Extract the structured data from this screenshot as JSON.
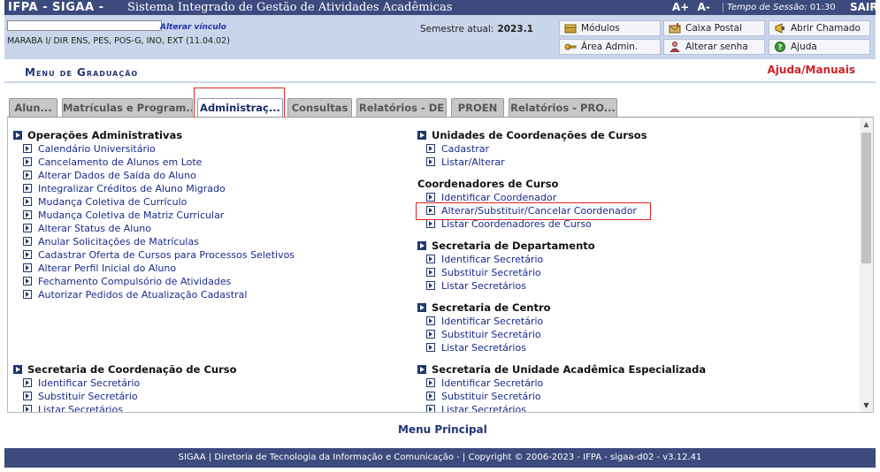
{
  "topbar": {
    "system": "IFPA - SIGAA -",
    "system_name": "Sistema Integrado de Gestão de Atividades Acadêmicas",
    "font_up": "A+",
    "font_down": "A-",
    "session_label": "Tempo de Sessão:",
    "session_time": "01:30",
    "logout": "SAIR"
  },
  "info": {
    "alterar_vinculo": "Alterar vínculo",
    "lotacao": "MARABA I/ DIR ENS, PES, POS-G, INO, EXT (11.04.02)",
    "semestre_label": "Semestre atual:",
    "semestre_value": "2023.1",
    "buttons": {
      "modulos": "Módulos",
      "caixa_postal": "Caixa Postal",
      "abrir_chamado": "Abrir Chamado",
      "area_admin": "Área Admin.",
      "alterar_senha": "Alterar senha",
      "ajuda": "Ajuda"
    }
  },
  "menu": {
    "title": "Menu de Graduação",
    "help": "Ajuda/Manuais"
  },
  "tabs": [
    "Alun...",
    "Matrículas e Program...",
    "Administraç...",
    "Consultas",
    "Relatórios - DE",
    "PROEN",
    "Relatórios - PRO..."
  ],
  "active_tab": "Administraç...",
  "sections": {
    "operacoes": {
      "title": "Operações Administrativas",
      "items": [
        "Calendário Universitário",
        "Cancelamento de Alunos em Lote",
        "Alterar Dados de Saída do Aluno",
        "Integralizar Créditos de Aluno Migrado",
        "Mudança Coletiva de Currículo",
        "Mudança Coletiva de Matriz Curricular",
        "Alterar Status de Aluno",
        "Anular Solicitações de Matrículas",
        "Cadastrar Oferta de Cursos para Processos Seletivos",
        "Alterar Perfil Inicial do Aluno",
        "Fechamento Compulsório de Atividades",
        "Autorizar Pedidos de Atualização Cadastral"
      ]
    },
    "sec_coord_curso": {
      "title": "Secretaria de Coordenação de Curso",
      "items": [
        "Identificar Secretário",
        "Substituir Secretário",
        "Listar Secretários"
      ]
    },
    "unidades_coord": {
      "title": "Unidades de Coordenações de Cursos",
      "items": [
        "Cadastrar",
        "Listar/Alterar"
      ]
    },
    "coordenadores": {
      "title": "Coordenadores de Curso",
      "items": [
        "Identificar Coordenador",
        "Alterar/Substituir/Cancelar Coordenador",
        "Listar Coordenadores de Curso"
      ]
    },
    "sec_depto": {
      "title": "Secretaria de Departamento",
      "items": [
        "Identificar Secretário",
        "Substituir Secretário",
        "Listar Secretários"
      ]
    },
    "sec_centro": {
      "title": "Secretaria de Centro",
      "items": [
        "Identificar Secretário",
        "Substituir Secretário",
        "Listar Secretários"
      ]
    },
    "sec_unidade": {
      "title": "Secretaria de Unidade Acadêmica Especializada",
      "items": [
        "Identificar Secretário",
        "Substituir Secretário",
        "Listar Secretários"
      ]
    }
  },
  "menu_principal": "Menu Principal",
  "footer": "SIGAA | Diretoria de Tecnologia da Informação e Comunicação - | Copyright © 2006-2023 - IFPA - sigaa-d02 - v3.12.41",
  "colors": {
    "header_bg": "#3c4a7d",
    "info_bg": "#c9d5ea",
    "link": "#1a2a8a",
    "help_red": "#cc2222"
  }
}
